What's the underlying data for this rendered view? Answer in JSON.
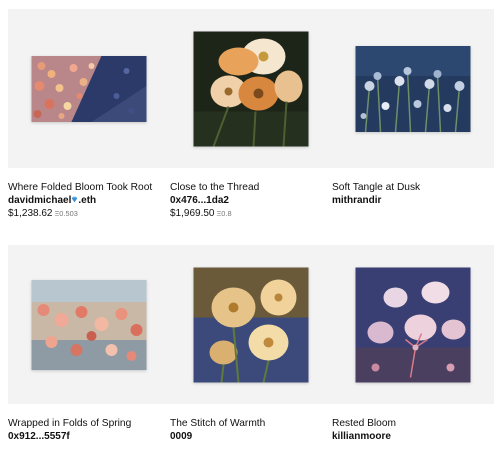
{
  "items": [
    {
      "title": "Where Folded Bloom Took Root",
      "artist": "davidmichael",
      "artist_suffix": ".eth",
      "artist_icon": "diamond-icon",
      "price": "$1,238.62",
      "eth": "Ξ0.503"
    },
    {
      "title": "Close to the Thread",
      "artist": "0x476...1da2",
      "price": "$1,969.50",
      "eth": "Ξ0.8"
    },
    {
      "title": "Soft Tangle at Dusk",
      "artist": "mithrandir"
    },
    {
      "title": "Wrapped in Folds of Spring",
      "artist": "0x912...5557f"
    },
    {
      "title": "The Stitch of Warmth",
      "artist": "0009"
    },
    {
      "title": "Rested Bloom",
      "artist": "killianmoore"
    }
  ],
  "colors": {
    "thumb_bg": "#f3f3f3",
    "diamond": "#5aa9e6"
  }
}
